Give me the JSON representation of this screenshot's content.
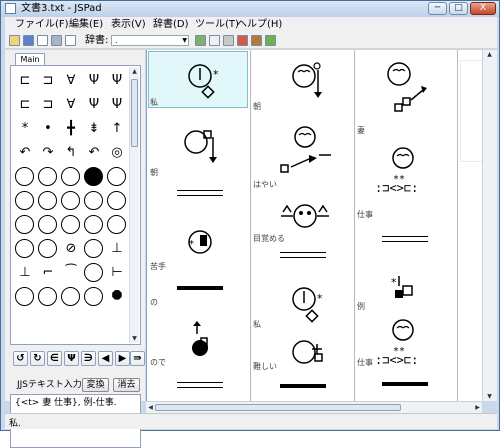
{
  "window": {
    "title": "文書3.txt - JSPad",
    "min_label": "─",
    "max_label": "□",
    "close_label": "X"
  },
  "menu": [
    "ファイル(F)",
    "編集(E)",
    "表示(V)",
    "辞書(D)",
    "ツール(T)",
    "ヘルプ(H)"
  ],
  "toolbar": {
    "dict_label": "辞書:",
    "dict_value": "."
  },
  "palette": {
    "tab": "Main"
  },
  "jis": {
    "label": "JJSテキスト入力:",
    "convert_label": "変換",
    "clear_label": "消去",
    "input_text": "{<t> 妻 仕事}, 例-仕事."
  },
  "document": {
    "labels": [
      "私",
      "朝",
      "苦手",
      "の",
      "ので",
      "朝",
      "はやい",
      "目覚める",
      "私",
      "難しい",
      "妻",
      "仕事",
      "例",
      "仕事"
    ]
  },
  "status": {
    "text": "私."
  }
}
